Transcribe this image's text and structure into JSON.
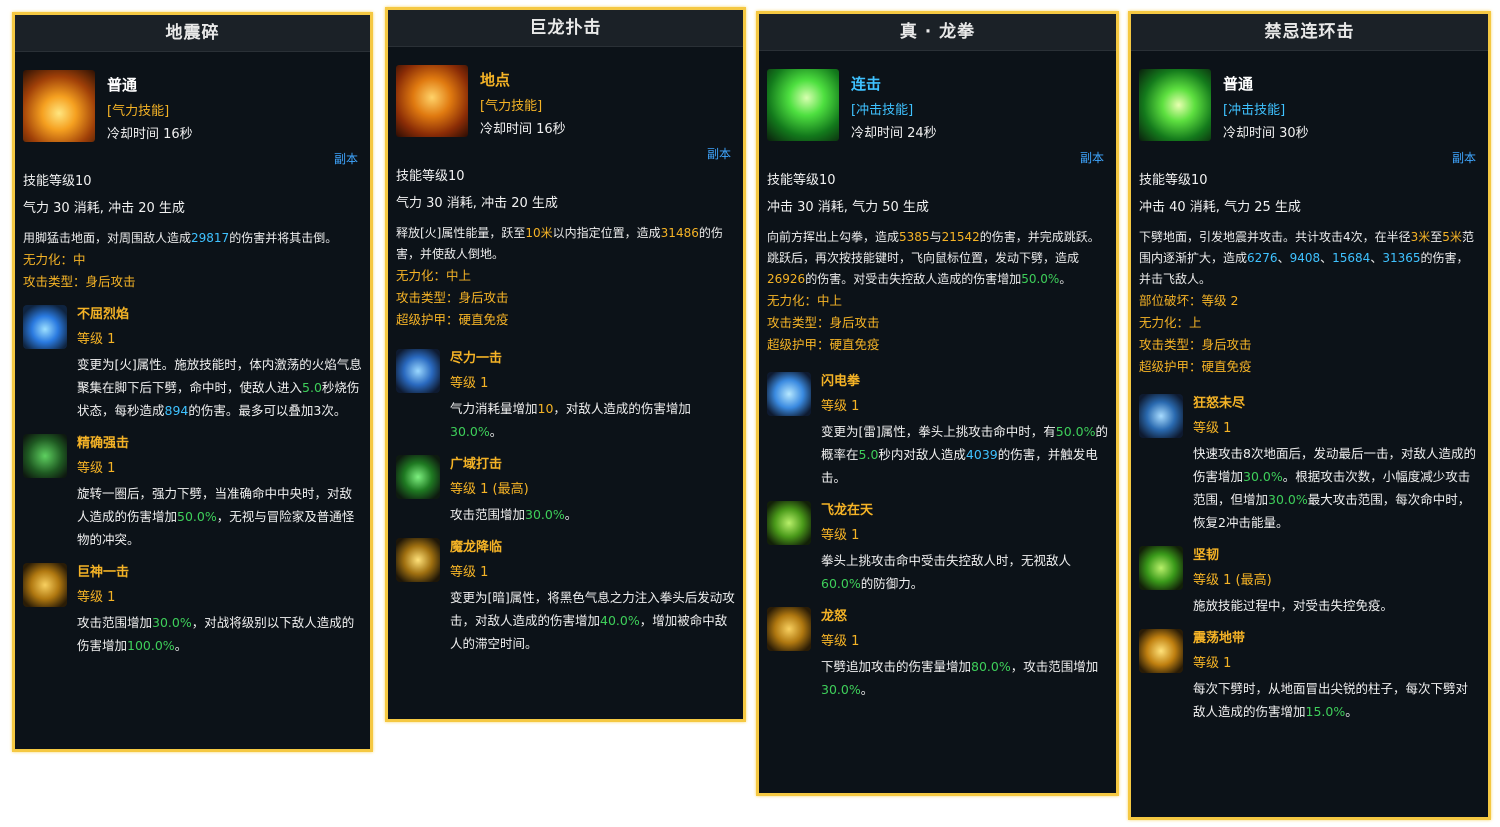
{
  "common": {
    "dungeon_label": "副本",
    "skill_level": "技能等级10"
  },
  "cards": [
    {
      "title": "地震碎",
      "type": "普通",
      "category": "[气力技能]",
      "cooldown": "冷却时间 16秒",
      "resource": "气力 30 消耗, 冲击 20 生成",
      "desc_a": "用脚猛击地面，对周围敌人造成",
      "desc_v1": "29817",
      "desc_b": "的伤害并将其击倒。",
      "prop1": "无力化：中",
      "prop2": "攻击类型：身后攻击",
      "runes": [
        {
          "name": "不屈烈焰",
          "level": "等级 1",
          "d1": "变更为[火]属性。施放技能时，体内激荡的火焰气息聚集在脚下后下劈，命中时，使敌人进入",
          "v1": "5.0",
          "d2": "秒烧伤状态，每秒造成",
          "v2": "894",
          "d3": "的伤害。最多可以叠加3次。"
        },
        {
          "name": "精确强击",
          "level": "等级 1",
          "d1": "旋转一圈后，强力下劈，当准确命中中央时，对敌人造成的伤害增加",
          "v1": "50.0%",
          "d2": "，无视与冒险家及普通怪物的冲突。"
        },
        {
          "name": "巨神一击",
          "level": "等级 1",
          "d1": "攻击范围增加",
          "v1": "30.0%",
          "d2": "，对战将级别以下敌人造成的伤害增加",
          "v2": "100.0%",
          "d3": "。"
        }
      ]
    },
    {
      "title": "巨龙扑击",
      "type": "地点",
      "category": "[气力技能]",
      "cooldown": "冷却时间 16秒",
      "resource": "气力 30 消耗, 冲击 20 生成",
      "desc_a": "释放[火]属性能量，跃至",
      "desc_v1": "10米",
      "desc_b": "以内指定位置，造成",
      "desc_v2": "31486",
      "desc_c": "的伤害，并使敌人倒地。",
      "prop1": "无力化：中上",
      "prop2": "攻击类型：身后攻击",
      "prop3": "超级护甲：硬直免疫",
      "runes": [
        {
          "name": "尽力一击",
          "level": "等级 1",
          "d1": "气力消耗量增加",
          "v1": "10",
          "d2": "，对敌人造成的伤害增加",
          "v2": "30.0%",
          "d3": "。"
        },
        {
          "name": "广域打击",
          "level": "等级 1 (最高)",
          "d1": "攻击范围增加",
          "v1": "30.0%",
          "d2": "。"
        },
        {
          "name": "魔龙降临",
          "level": "等级 1",
          "d1": "变更为[暗]属性，将黑色气息之力注入拳头后发动攻击，对敌人造成的伤害增加",
          "v1": "40.0%",
          "d2": "，增加被命中敌人的滞空时间。"
        }
      ]
    },
    {
      "title": "真 · 龙拳",
      "type": "连击",
      "category": "[冲击技能]",
      "cooldown": "冷却时间 24秒",
      "resource": "冲击 30 消耗, 气力 50 生成",
      "desc_a": "向前方挥出上勾拳，造成",
      "desc_v1": "5385",
      "desc_b": "与",
      "desc_v2": "21542",
      "desc_c": "的伤害，并完成跳跃。跳跃后，再次按技能键时，飞向鼠标位置，发动下劈，造成",
      "desc_v3": "26926",
      "desc_d": "的伤害。对受击失控敌人造成的伤害增加",
      "desc_v4": "50.0%",
      "desc_e": "。",
      "prop1": "无力化：中上",
      "prop2": "攻击类型：身后攻击",
      "prop3": "超级护甲：硬直免疫",
      "runes": [
        {
          "name": "闪电拳",
          "level": "等级 1",
          "d1": "变更为[雷]属性，拳头上挑攻击命中时，有",
          "v1": "50.0%",
          "d2": "的概率在",
          "v2": "5.0",
          "d3": "秒内对敌人造成",
          "v3": "4039",
          "d4": "的伤害，并触发电击。"
        },
        {
          "name": "飞龙在天",
          "level": "等级 1",
          "d1": "拳头上挑攻击命中受击失控敌人时，无视敌人",
          "v1": "60.0%",
          "d2": "的防御力。"
        },
        {
          "name": "龙怒",
          "level": "等级 1",
          "d1": "下劈追加攻击的伤害量增加",
          "v1": "80.0%",
          "d2": "，攻击范围增加",
          "v2": "30.0%",
          "d3": "。"
        }
      ]
    },
    {
      "title": "禁忌连环击",
      "type": "普通",
      "category": "[冲击技能]",
      "cooldown": "冷却时间 30秒",
      "resource": "冲击 40 消耗, 气力 25 生成",
      "desc_a": "下劈地面，引发地震并攻击。共计攻击4次，在半径",
      "desc_v1": "3米",
      "desc_b": "至",
      "desc_v2": "5米",
      "desc_c": "范围内逐渐扩大，造成",
      "desc_v3": "6276",
      "desc_d": "、",
      "desc_v4": "9408",
      "desc_e": "、",
      "desc_v5": "15684",
      "desc_f": "、",
      "desc_v6": "31365",
      "desc_g": "的伤害，并击飞敌人。",
      "prop0": "部位破坏：等级 2",
      "prop1": "无力化：上",
      "prop2": "攻击类型：身后攻击",
      "prop3": "超级护甲：硬直免疫",
      "runes": [
        {
          "name": "狂怒未尽",
          "level": "等级 1",
          "d1": "快速攻击8次地面后，发动最后一击，对敌人造成的伤害增加",
          "v1": "30.0%",
          "d2": "。根据攻击次数，小幅度减少攻击范围，但增加",
          "v2": "30.0%",
          "d3": "最大攻击范围，每次命中时，恢复2冲击能量。"
        },
        {
          "name": "坚韧",
          "level": "等级 1 (最高)",
          "d1": "施放技能过程中，对受击失控免疫。"
        },
        {
          "name": "震荡地带",
          "level": "等级 1",
          "d1": "每次下劈时，从地面冒出尖锐的柱子，每次下劈对敌人造成的伤害增加",
          "v1": "15.0%",
          "d2": "。"
        }
      ]
    }
  ]
}
